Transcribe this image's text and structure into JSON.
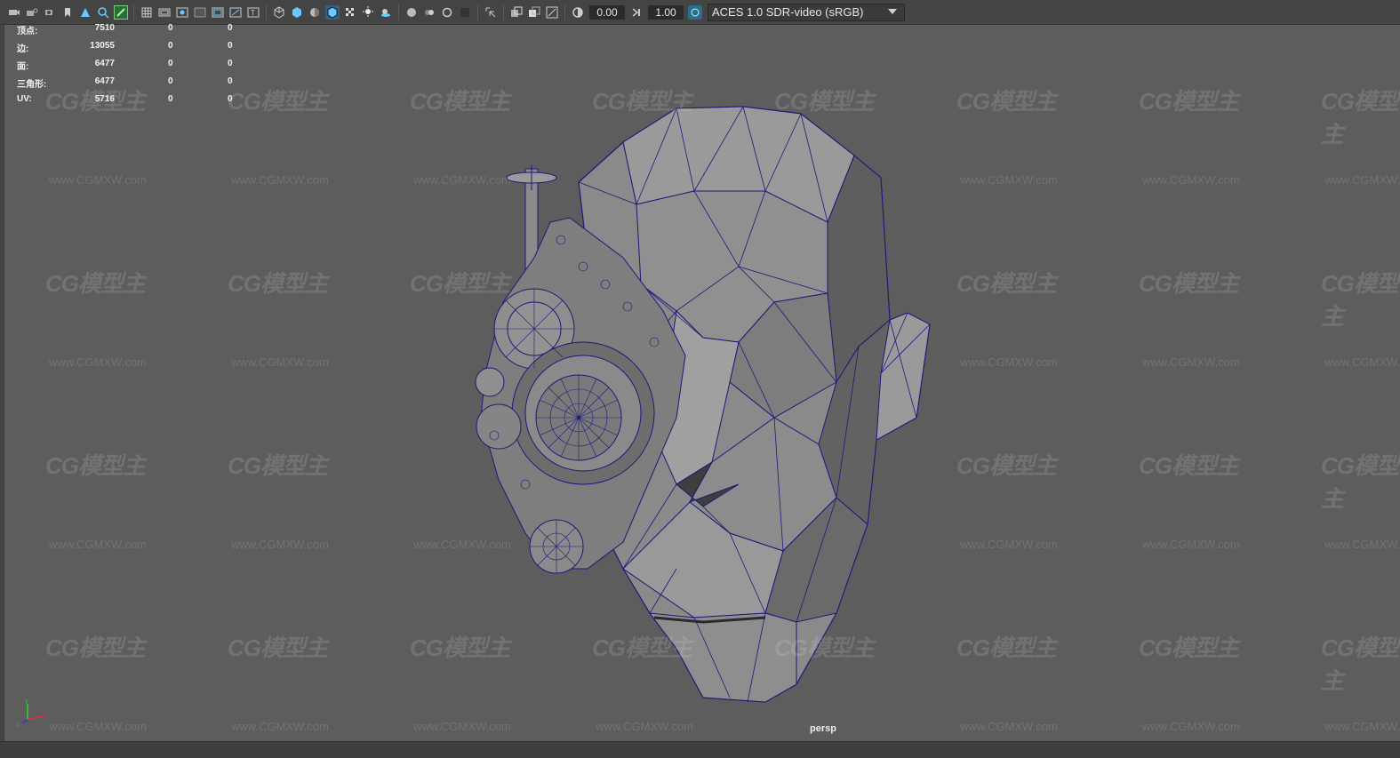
{
  "toolbar": {
    "exposure_value": "0.00",
    "gamma_value": "1.00",
    "color_space": "ACES 1.0 SDR-video (sRGB)"
  },
  "hud": {
    "rows": [
      {
        "label": "顶点:",
        "v1": "7510",
        "v2": "0",
        "v3": "0"
      },
      {
        "label": "边:",
        "v1": "13055",
        "v2": "0",
        "v3": "0"
      },
      {
        "label": "面:",
        "v1": "6477",
        "v2": "0",
        "v3": "0"
      },
      {
        "label": "三角形:",
        "v1": "6477",
        "v2": "0",
        "v3": "0"
      },
      {
        "label": "UV:",
        "v1": "5716",
        "v2": "0",
        "v3": "0"
      }
    ]
  },
  "viewport": {
    "camera": "persp",
    "axis_y": "y",
    "axis_x": "x",
    "axis_z": "z"
  },
  "watermark": {
    "logo": "CG模型主",
    "url": "www.CGMXW.com"
  },
  "colors": {
    "viewport_bg": "#5d5d5d",
    "wireframe": "#1a1a7a",
    "mesh_fill": "#8a8a8a"
  }
}
